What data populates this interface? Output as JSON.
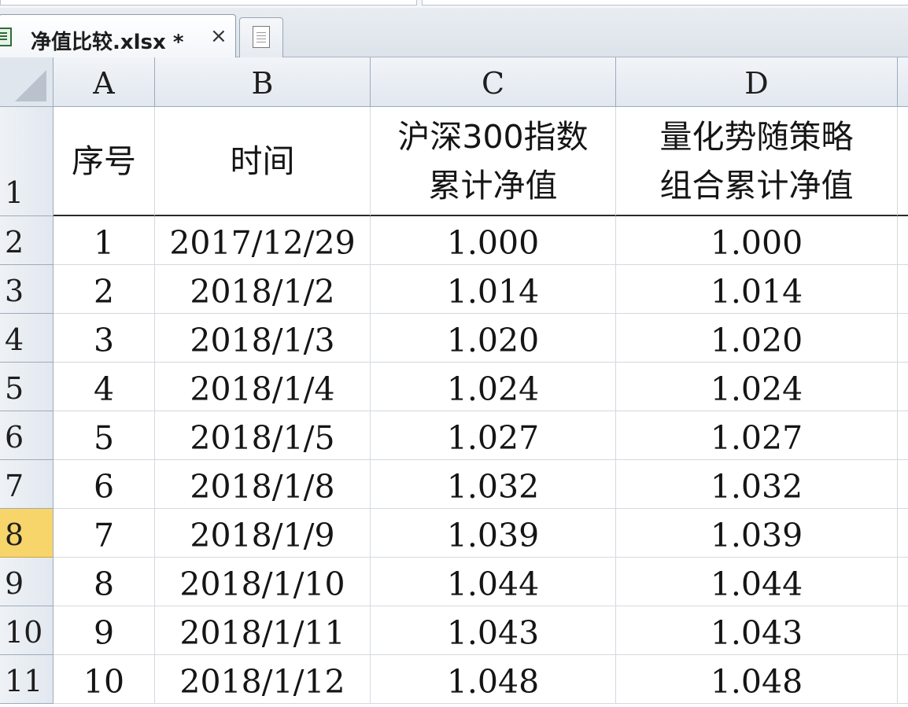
{
  "tab": {
    "title": "净值比较.xlsx *",
    "close_glyph": "×"
  },
  "columns": [
    "A",
    "B",
    "C",
    "D"
  ],
  "rows": [
    "1",
    "2",
    "3",
    "4",
    "5",
    "6",
    "7",
    "8",
    "9",
    "10",
    "11"
  ],
  "selected_row": "8",
  "header_row": {
    "a": "序号",
    "b": "时间",
    "c_line1": "沪深300指数",
    "c_line2": "累计净值",
    "d_line1": "量化势随策略",
    "d_line2": "组合累计净值"
  },
  "data_rows": [
    {
      "seq": "1",
      "date": "2017/12/29",
      "csi300": "1.000",
      "strategy": "1.000"
    },
    {
      "seq": "2",
      "date": "2018/1/2",
      "csi300": "1.014",
      "strategy": "1.014"
    },
    {
      "seq": "3",
      "date": "2018/1/3",
      "csi300": "1.020",
      "strategy": "1.020"
    },
    {
      "seq": "4",
      "date": "2018/1/4",
      "csi300": "1.024",
      "strategy": "1.024"
    },
    {
      "seq": "5",
      "date": "2018/1/5",
      "csi300": "1.027",
      "strategy": "1.027"
    },
    {
      "seq": "6",
      "date": "2018/1/8",
      "csi300": "1.032",
      "strategy": "1.032"
    },
    {
      "seq": "7",
      "date": "2018/1/9",
      "csi300": "1.039",
      "strategy": "1.039"
    },
    {
      "seq": "8",
      "date": "2018/1/10",
      "csi300": "1.044",
      "strategy": "1.044"
    },
    {
      "seq": "9",
      "date": "2018/1/11",
      "csi300": "1.043",
      "strategy": "1.043"
    },
    {
      "seq": "10",
      "date": "2018/1/12",
      "csi300": "1.048",
      "strategy": "1.048"
    }
  ],
  "colors": {
    "selected_row_header": "#f8d56a",
    "grid_line": "#d4d9df",
    "header_bg": "#e2e8ef"
  },
  "icons": {
    "file": "excel-file-icon",
    "new_tab": "new-document-icon",
    "select_all": "select-all-triangle-icon"
  }
}
